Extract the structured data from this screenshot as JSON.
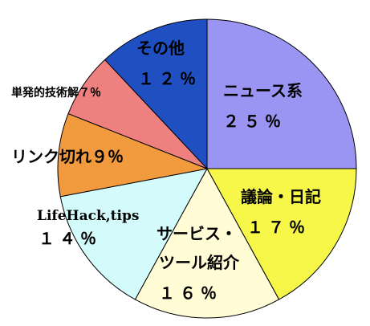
{
  "chart_data": {
    "type": "pie",
    "title": "",
    "slices": [
      {
        "category": "ニュース系",
        "value": 25,
        "color": "#9A95F2"
      },
      {
        "category": "議論・日記",
        "value": 17,
        "color": "#F7F74A"
      },
      {
        "category": "サービス・ツール紹介",
        "value": 16,
        "color": "#FFFCD6"
      },
      {
        "category": "LifeHack,tips",
        "value": 14,
        "color": "#D4FBFC"
      },
      {
        "category": "リンク切れ",
        "value": 9,
        "color": "#F29A3E"
      },
      {
        "category": "単発的技術解",
        "value": 7,
        "color": "#EE8080"
      },
      {
        "category": "その他",
        "value": 12,
        "color": "#1F4FC1"
      }
    ],
    "labels": {
      "news": {
        "line1": "ニュース系",
        "line2": "２５％"
      },
      "discussion": {
        "line1": "議論・日記",
        "line2": "１７％"
      },
      "service": {
        "line1": "サービス・",
        "line2": "ツール紹介",
        "line3": "１６％"
      },
      "lifehack": {
        "line1": "LifeHack,tips",
        "line2": "１４％"
      },
      "broken": {
        "line1": "リンク切れ９％"
      },
      "tech": {
        "line1": "単発的技術解７％"
      },
      "other": {
        "line1": "その他",
        "line2": "１２％"
      }
    }
  }
}
